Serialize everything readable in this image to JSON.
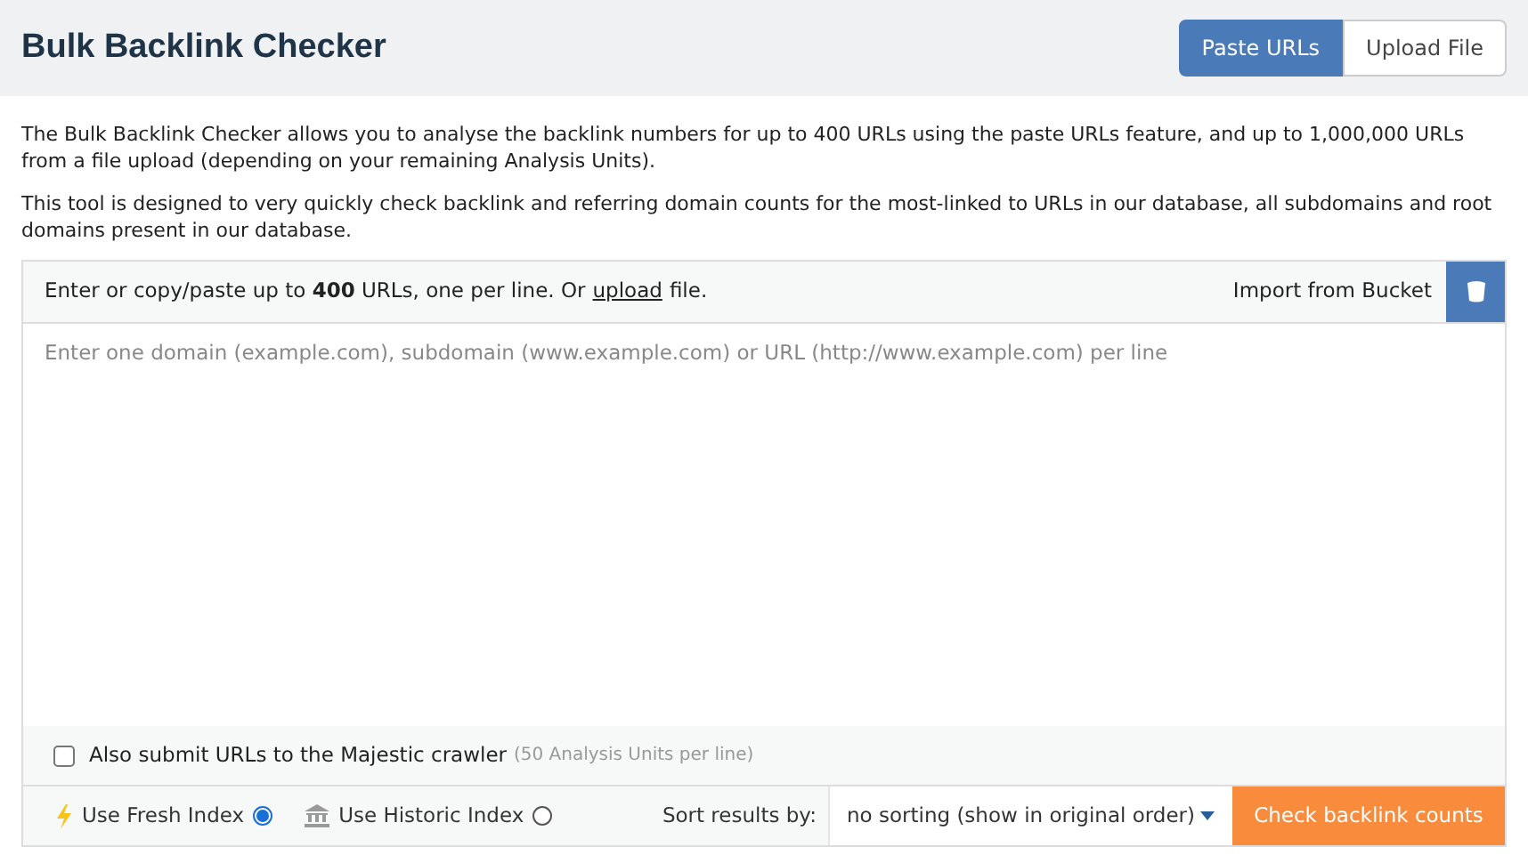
{
  "header": {
    "title": "Bulk Backlink Checker",
    "tabs": [
      {
        "label": "Paste URLs",
        "selected": true
      },
      {
        "label": "Upload File",
        "selected": false
      }
    ]
  },
  "intro": [
    "The Bulk Backlink Checker allows you to analyse the backlink numbers for up to 400 URLs using the paste URLs feature, and up to 1,000,000 URLs from a file upload (depending on your remaining Analysis Units).",
    "This tool is designed to very quickly check backlink and referring domain counts for the most-linked to URLs in our database, all subdomains and root domains present in our database."
  ],
  "input_panel": {
    "instruction": "Enter or copy/paste up to **400** URLs, one per line. Or",
    "upload_link": "upload",
    "instruction_end": "file.",
    "import_label": "Import from Bucket",
    "placeholder": "Enter one domain (example.com), subdomain (www.example.com) or URL (http://www.example.com) per line"
  },
  "crawler_option": {
    "label": "Also submit URLs to the Majestic crawler",
    "note": "(50 Analysis Units per line)",
    "checked": false
  },
  "index_options": [
    {
      "label": "Use Fresh Index",
      "kind": "fresh",
      "selected": true
    },
    {
      "label": "Use Historic Index",
      "kind": "historic",
      "selected": false
    }
  ],
  "sort": {
    "label": "Sort results by:",
    "value": "no sorting (show in original order)"
  },
  "submit_button": "Check backlink counts"
}
